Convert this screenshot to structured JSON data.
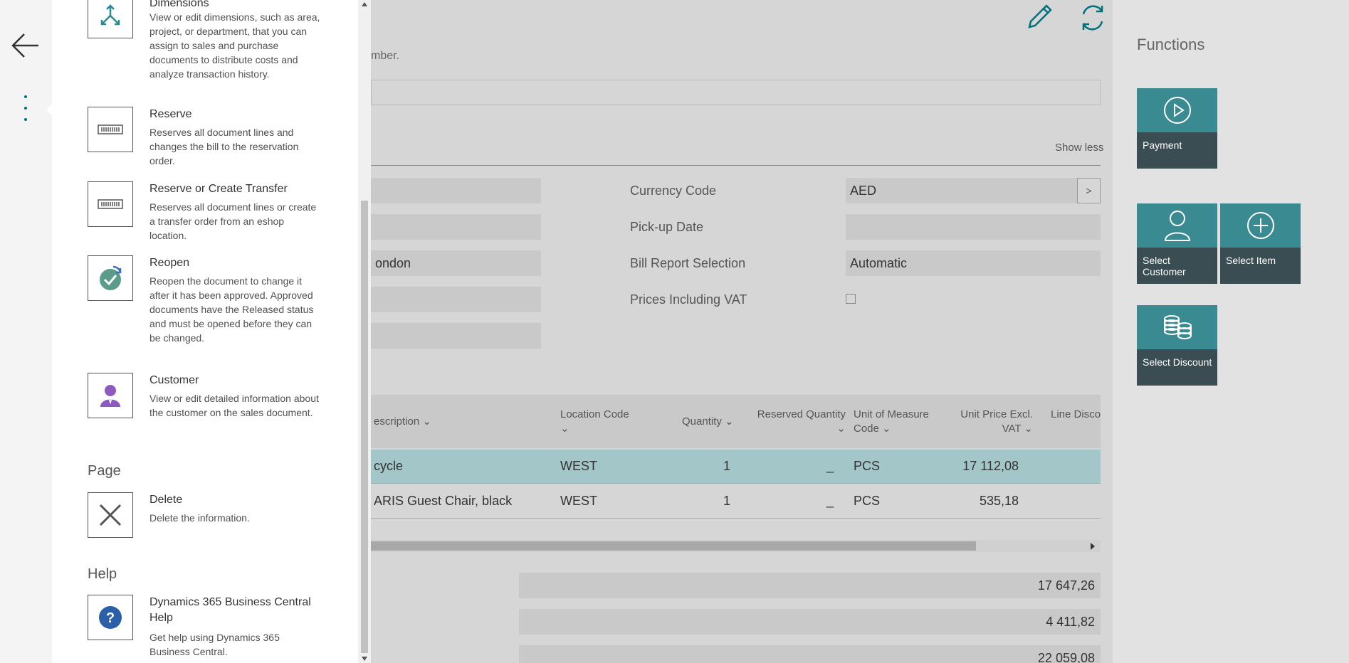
{
  "panel": {
    "actions": [
      {
        "title": "Dimensions",
        "desc": "View or edit dimensions, such as area, project, or department, that you can assign to sales and purchase documents to distribute costs and analyze transaction history."
      },
      {
        "title": "Reserve",
        "desc": "Reserves all document lines and changes the bill to the reservation order."
      },
      {
        "title": "Reserve or Create Transfer",
        "desc": "Reserves all document lines or create a transfer order from an eshop location."
      },
      {
        "title": "Reopen",
        "desc": "Reopen the document to change it after it has been approved. Approved documents have the Released status and must be opened before they can be changed."
      },
      {
        "title": "Customer",
        "desc": "View or edit detailed information about the customer on the sales document."
      }
    ],
    "section_page": "Page",
    "delete": {
      "title": "Delete",
      "desc": "Delete the information."
    },
    "section_help": "Help",
    "help": {
      "title": "Dynamics 365 Business Central Help",
      "desc": "Get help using Dynamics 365 Business Central."
    }
  },
  "page": {
    "hint": "mber.",
    "show_less": "Show less",
    "left_fields": [
      "",
      "",
      "ondon",
      "",
      ""
    ],
    "labels": [
      "Currency Code",
      "Pick-up Date",
      "Bill Report Selection",
      "Prices Including VAT"
    ],
    "values": {
      "currency": "AED",
      "pickup": "",
      "bill_report": "Automatic"
    },
    "lookup": ">"
  },
  "grid": {
    "headers": {
      "description": "escription",
      "location": "Location Code",
      "quantity": "Quantity",
      "reserved": "Reserved Quantity",
      "uom": "Unit of Measure Code",
      "unit_price": "Unit Price Excl. VAT",
      "line_disc": "Line Discou"
    },
    "rows": [
      {
        "description": "cycle",
        "location": "WEST",
        "quantity": "1",
        "reserved": "_",
        "uom": "PCS",
        "unit_price": "17 112,08"
      },
      {
        "description": "ARIS Guest Chair, black",
        "location": "WEST",
        "quantity": "1",
        "reserved": "_",
        "uom": "PCS",
        "unit_price": "535,18"
      }
    ]
  },
  "totals": [
    "17 647,26",
    "4 411,82",
    "22 059,08"
  ],
  "functions": {
    "title": "Functions",
    "tiles": [
      {
        "label": "Payment",
        "icon": "play-circle-icon"
      },
      {
        "label": "Select Customer",
        "icon": "person-icon"
      },
      {
        "label": "Select Item",
        "icon": "plus-circle-icon"
      },
      {
        "label": "Select Discount",
        "icon": "coins-icon"
      }
    ]
  },
  "colors": {
    "accent": "#00707a",
    "tile_top": "#3a8a91",
    "tile_bottom": "#3a4d52",
    "selected_row": "#a3c6c8"
  }
}
